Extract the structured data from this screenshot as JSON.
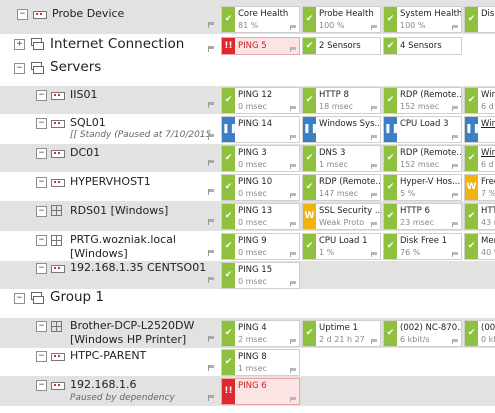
{
  "rows": {
    "probe": {
      "name": "Probe Device",
      "sensors": [
        {
          "name": "Core Health",
          "value": "81 %",
          "status": "ok"
        },
        {
          "name": "Probe Health",
          "value": "100 %",
          "status": "ok"
        },
        {
          "name": "System Health",
          "value": "100 %",
          "status": "ok"
        },
        {
          "name": "Disk",
          "value": "",
          "status": "ok"
        }
      ]
    },
    "internet": {
      "name": "Internet Connection",
      "sensors": [
        {
          "name": "PING 5",
          "value": "",
          "status": "down"
        },
        {
          "name": "2 Sensors",
          "value": "",
          "status": "ok"
        },
        {
          "name": "4 Sensors",
          "value": "",
          "status": "ok"
        }
      ]
    },
    "servers": {
      "name": "Servers"
    },
    "iis01": {
      "name": "IIS01",
      "sensors": [
        {
          "name": "PING 12",
          "value": "0 msec",
          "status": "ok"
        },
        {
          "name": "HTTP 8",
          "value": "18 msec",
          "status": "ok"
        },
        {
          "name": "RDP (Remote...",
          "value": "152 msec",
          "status": "ok"
        },
        {
          "name": "Win",
          "value": "6 d",
          "status": "ok"
        }
      ]
    },
    "sql01": {
      "name": "SQL01",
      "subtext": "[[ Standy (Paused at 7/10/2015",
      "sensors": [
        {
          "name": "PING 14",
          "value": "",
          "status": "paused"
        },
        {
          "name": "Windows Sys...",
          "value": "",
          "status": "paused"
        },
        {
          "name": "CPU Load 3",
          "value": "",
          "status": "paused"
        },
        {
          "name": "Win",
          "value": "",
          "status": "paused"
        }
      ]
    },
    "dc01": {
      "name": "DC01",
      "sensors": [
        {
          "name": "PING 3",
          "value": "0 msec",
          "status": "ok"
        },
        {
          "name": "DNS 3",
          "value": "1 msec",
          "status": "ok"
        },
        {
          "name": "RDP (Remote...",
          "value": "152 msec",
          "status": "ok"
        },
        {
          "name": "Win",
          "value": "6 d",
          "status": "ok"
        }
      ]
    },
    "hypervhost1": {
      "name": "HYPERVHOST1",
      "sensors": [
        {
          "name": "PING 10",
          "value": "0 msec",
          "status": "ok"
        },
        {
          "name": "RDP (Remote...",
          "value": "147 msec",
          "status": "ok"
        },
        {
          "name": "Hyper-V Hos...",
          "value": "5 %",
          "status": "ok"
        },
        {
          "name": "Free",
          "value": "7 %",
          "status": "warn"
        }
      ]
    },
    "rds01": {
      "name": "RDS01 [Windows]",
      "sensors": [
        {
          "name": "PING 13",
          "value": "0 msec",
          "status": "ok"
        },
        {
          "name": "SSL Security ...",
          "value": "Weak Proto",
          "status": "warn"
        },
        {
          "name": "HTTP 6",
          "value": "23 msec",
          "status": "ok"
        },
        {
          "name": "HTT",
          "value": "43 m",
          "status": "ok"
        }
      ]
    },
    "prtg": {
      "name": "PRTG.wozniak.local",
      "name2": "[Windows]",
      "sensors": [
        {
          "name": "PING 9",
          "value": "0 msec",
          "status": "ok"
        },
        {
          "name": "CPU Load 1",
          "value": "1 %",
          "status": "ok"
        },
        {
          "name": "Disk Free 1",
          "value": "76 %",
          "status": "ok"
        },
        {
          "name": "Mem",
          "value": "40 %",
          "status": "ok"
        }
      ]
    },
    "centos": {
      "name": "192.168.1.35 CENTSO01",
      "sensors": [
        {
          "name": "PING 15",
          "value": "0 msec",
          "status": "ok"
        }
      ]
    },
    "group1": {
      "name": "Group 1"
    },
    "brother": {
      "name": "Brother-DCP-L2520DW",
      "name2": "[Windows HP Printer]",
      "sensors": [
        {
          "name": "PING 4",
          "value": "2 msec",
          "status": "ok"
        },
        {
          "name": "Uptime 1",
          "value": "2 d 21 h 27",
          "status": "ok"
        },
        {
          "name": "(002) NC-870...",
          "value": "6 kbit/s",
          "status": "ok"
        },
        {
          "name": "(00",
          "value": "0 kb",
          "status": "ok"
        }
      ]
    },
    "htpc": {
      "name": "HTPC-PARENT",
      "sensors": [
        {
          "name": "PING 8",
          "value": "1 msec",
          "status": "ok"
        }
      ]
    },
    "ip16": {
      "name": "192.168.1.6",
      "subtext": "Paused by dependency",
      "sensors": [
        {
          "name": "PING 6",
          "value": "",
          "status": "down"
        }
      ]
    }
  },
  "colors": {
    "ok": "#8fc13e",
    "down": "#e0282c",
    "paused": "#3c7fc4",
    "warn": "#f2b311"
  }
}
